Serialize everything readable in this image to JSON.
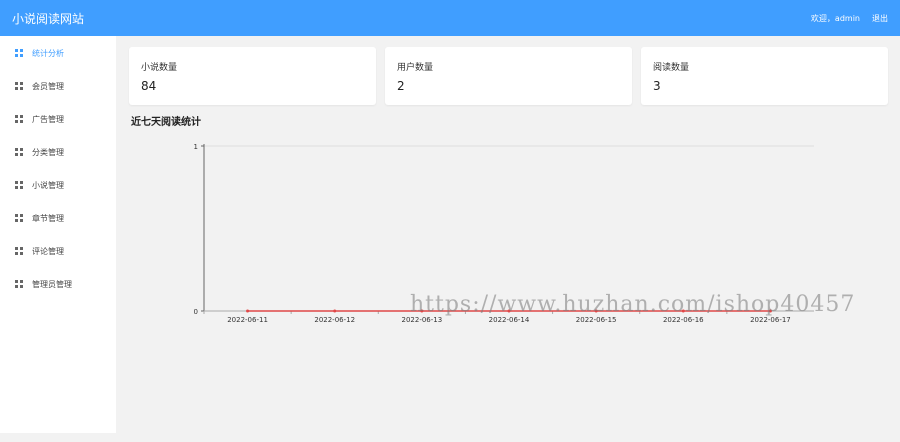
{
  "header": {
    "title": "小说阅读网站",
    "welcome": "欢迎，admin",
    "logout": "退出"
  },
  "sidebar": {
    "items": [
      {
        "label": "统计分析",
        "active": true
      },
      {
        "label": "会员管理",
        "active": false
      },
      {
        "label": "广告管理",
        "active": false
      },
      {
        "label": "分类管理",
        "active": false
      },
      {
        "label": "小说管理",
        "active": false
      },
      {
        "label": "章节管理",
        "active": false
      },
      {
        "label": "评论管理",
        "active": false
      },
      {
        "label": "管理员管理",
        "active": false
      }
    ]
  },
  "stats": {
    "novels_label": "小说数量",
    "novels_value": "84",
    "users_label": "用户数量",
    "users_value": "2",
    "reads_label": "阅读数量",
    "reads_value": "3"
  },
  "chart_title": "近七天阅读统计",
  "chart_data": {
    "type": "line",
    "categories": [
      "2022-06-11",
      "2022-06-12",
      "2022-06-13",
      "2022-06-14",
      "2022-06-15",
      "2022-06-16",
      "2022-06-17"
    ],
    "series": [
      {
        "values": [
          0,
          0,
          0,
          0,
          0,
          0,
          0
        ]
      }
    ],
    "ylim": [
      0,
      1
    ],
    "yticks": [
      "0",
      "1"
    ],
    "line_color": "#e04848",
    "grid": true
  },
  "watermark": "https://www.huzhan.com/ishop40457"
}
